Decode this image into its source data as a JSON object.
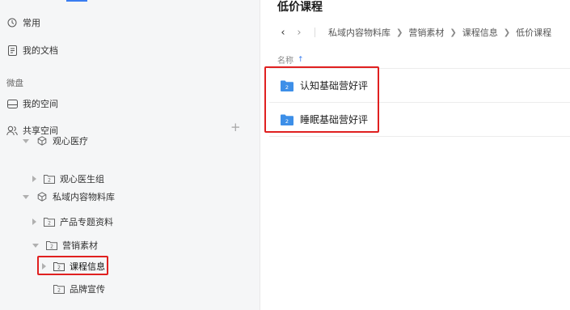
{
  "sidebar": {
    "items": [
      {
        "label": "常用",
        "icon": "clock-icon"
      },
      {
        "label": "我的文档",
        "icon": "document-icon"
      }
    ],
    "section_weipan": "微盘",
    "my_space": {
      "label": "我的空间",
      "icon": "hard-drive-icon"
    },
    "shared_space": {
      "label": "共享空间",
      "icon": "users-icon",
      "add": "+"
    },
    "tree": [
      {
        "label": "观心医疗",
        "expanded": true
      },
      {
        "label": "观心医生组",
        "expanded": false
      },
      {
        "label": "私域内容物料库",
        "expanded": true
      },
      {
        "label": "产品专题资料",
        "expanded": false
      },
      {
        "label": "营销素材",
        "expanded": true
      },
      {
        "label": "课程信息",
        "expanded": false,
        "selected": true
      },
      {
        "label": "品牌宣传"
      }
    ]
  },
  "main": {
    "title": "低价课程",
    "breadcrumb": [
      "私域内容物料库",
      "营销素材",
      "课程信息",
      "低价课程"
    ],
    "column_name": "名称",
    "files": [
      {
        "name": "认知基础营好评",
        "icon": "shared-folder-icon"
      },
      {
        "name": "睡眠基础营好评",
        "icon": "shared-folder-icon"
      }
    ]
  },
  "colors": {
    "accent": "#3a7df0",
    "highlight": "#e02020",
    "folder": "#3d8fe8"
  }
}
